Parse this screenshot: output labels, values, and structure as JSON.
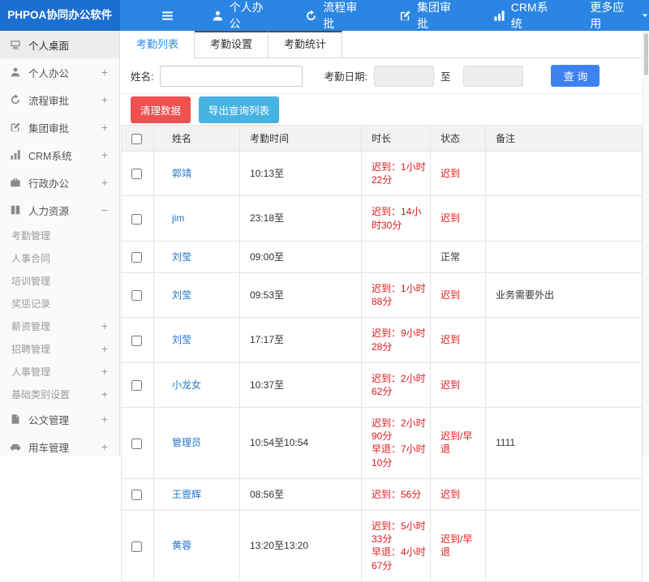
{
  "topbar": {
    "logo": "PHPOA协同办公软件",
    "nav": [
      {
        "label": "个人办公",
        "icon": "person-icon"
      },
      {
        "label": "流程审批",
        "icon": "flow-icon"
      },
      {
        "label": "集团审批",
        "icon": "edit-icon"
      },
      {
        "label": "CRM系统",
        "icon": "chart-icon"
      },
      {
        "label": "更多应用",
        "icon": "chevron-down-icon"
      }
    ]
  },
  "sidebar": {
    "items": [
      {
        "label": "个人桌面",
        "expand": ""
      },
      {
        "label": "个人办公",
        "expand": "+"
      },
      {
        "label": "流程审批",
        "expand": "+"
      },
      {
        "label": "集团审批",
        "expand": "+"
      },
      {
        "label": "CRM系统",
        "expand": "+"
      },
      {
        "label": "行政办公",
        "expand": "+"
      },
      {
        "label": "人力资源",
        "expand": "−"
      },
      {
        "label": "考勤管理",
        "expand": ""
      },
      {
        "label": "人事合同",
        "expand": ""
      },
      {
        "label": "培训管理",
        "expand": ""
      },
      {
        "label": "奖惩记录",
        "expand": ""
      },
      {
        "label": "薪资管理",
        "expand": "+"
      },
      {
        "label": "招聘管理",
        "expand": "+"
      },
      {
        "label": "人事管理",
        "expand": "+"
      },
      {
        "label": "基础类别设置",
        "expand": "+"
      },
      {
        "label": "公文管理",
        "expand": "+"
      },
      {
        "label": "用车管理",
        "expand": "+"
      }
    ]
  },
  "tabs": [
    {
      "label": "考勤列表"
    },
    {
      "label": "考勤设置"
    },
    {
      "label": "考勤统计"
    }
  ],
  "filter": {
    "name_label": "姓名:",
    "date_label": "考勤日期:",
    "to_label": "至",
    "search_button": "查 询"
  },
  "actions": {
    "clean_button": "清理数据",
    "export_button": "导出查询列表"
  },
  "table": {
    "headers": [
      "姓名",
      "考勤时间",
      "时长",
      "状态",
      "备注"
    ],
    "rows": [
      {
        "name": "郭靖",
        "time": "10:13至",
        "duration": "迟到：1小时22分",
        "status": "迟到",
        "note": ""
      },
      {
        "name": "jim",
        "time": "23:18至",
        "duration": "迟到：14小时30分",
        "status": "迟到",
        "note": ""
      },
      {
        "name": "刘莹",
        "time": "09:00至",
        "duration": "",
        "status": "正常",
        "note": ""
      },
      {
        "name": "刘莹",
        "time": "09:53至",
        "duration": "迟到：1小时88分",
        "status": "迟到",
        "note": "业务需要外出"
      },
      {
        "name": "刘莹",
        "time": "17:17至",
        "duration": "迟到：9小时28分",
        "status": "迟到",
        "note": ""
      },
      {
        "name": "小龙女",
        "time": "10:37至",
        "duration": "迟到：2小时62分",
        "status": "迟到",
        "note": ""
      },
      {
        "name": "管理员",
        "time": "10:54至10:54",
        "duration": "迟到：2小时90分\n早退：7小时10分",
        "status": "迟到/早退",
        "note": "1111"
      },
      {
        "name": "王壹辉",
        "time": "08:56至",
        "duration": "迟到：56分",
        "status": "迟到",
        "note": ""
      },
      {
        "name": "黄蓉",
        "time": "13:20至13:20",
        "duration": "迟到：5小时33分\n早退：4小时67分",
        "status": "迟到/早退",
        "note": ""
      }
    ]
  },
  "colors": {
    "topbar": "#2b85e2",
    "logo_bg": "#1a6fd0",
    "accent": "#2d8cf0",
    "danger": "#e01818",
    "clean_button": "#ef5050",
    "export_button": "#47b3e3",
    "search_button": "#3e82f0"
  }
}
